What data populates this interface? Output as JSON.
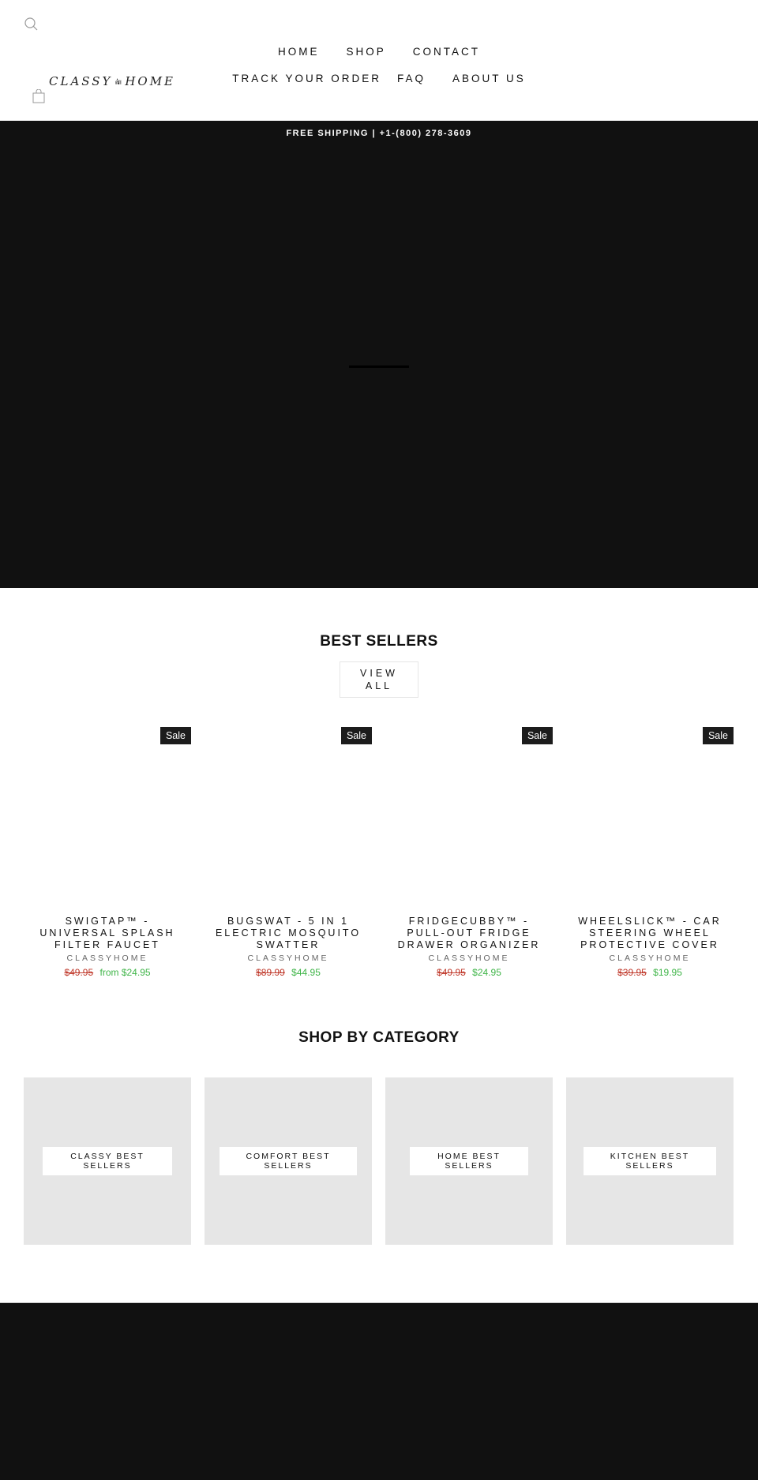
{
  "header": {
    "logo": {
      "left_word": "CLASSY",
      "right_word": "HOME"
    },
    "icons": {
      "search": "search-icon",
      "cart": "shopping-bag-icon"
    },
    "nav_rows": [
      [
        {
          "label": "HOME"
        },
        {
          "label": "SHOP"
        },
        {
          "label": "CONTACT"
        }
      ],
      [
        {
          "label": "TRACK YOUR ORDER"
        },
        {
          "label": "FAQ"
        },
        {
          "label": "ABOUT US"
        }
      ]
    ]
  },
  "announcement": {
    "text": "FREE SHIPPING | +1-(800) 278-3609"
  },
  "best_sellers": {
    "title": "BEST SELLERS",
    "view_all_line1": "VIEW",
    "view_all_line2": "ALL",
    "products": [
      {
        "badge": "Sale",
        "title": "SWIGTAP™ - UNIVERSAL SPLASH FILTER FAUCET",
        "vendor": "CLASSYHOME",
        "compare_price": "$49.95",
        "price": "from $24.95"
      },
      {
        "badge": "Sale",
        "title": "BUGSWAT - 5 IN 1 ELECTRIC MOSQUITO SWATTER",
        "vendor": "CLASSYHOME",
        "compare_price": "$89.99",
        "price": "$44.95"
      },
      {
        "badge": "Sale",
        "title": "FRIDGECUBBY™ - PULL-OUT FRIDGE DRAWER ORGANIZER",
        "vendor": "CLASSYHOME",
        "compare_price": "$49.95",
        "price": "$24.95"
      },
      {
        "badge": "Sale",
        "title": "WHEELSLICK™ - CAR STEERING WHEEL PROTECTIVE COVER",
        "vendor": "CLASSYHOME",
        "compare_price": "$39.95",
        "price": "$19.95"
      }
    ]
  },
  "shop_by_category": {
    "title": "SHOP BY CATEGORY",
    "categories": [
      {
        "label": "CLASSY BEST SELLERS"
      },
      {
        "label": "COMFORT BEST SELLERS"
      },
      {
        "label": "HOME BEST SELLERS"
      },
      {
        "label": "KITCHEN BEST SELLERS"
      }
    ]
  },
  "colors": {
    "sale_price": "#3fb548",
    "compare_price": "#c0392b",
    "dark_bg": "#111111",
    "tile_bg": "#e6e6e6"
  }
}
